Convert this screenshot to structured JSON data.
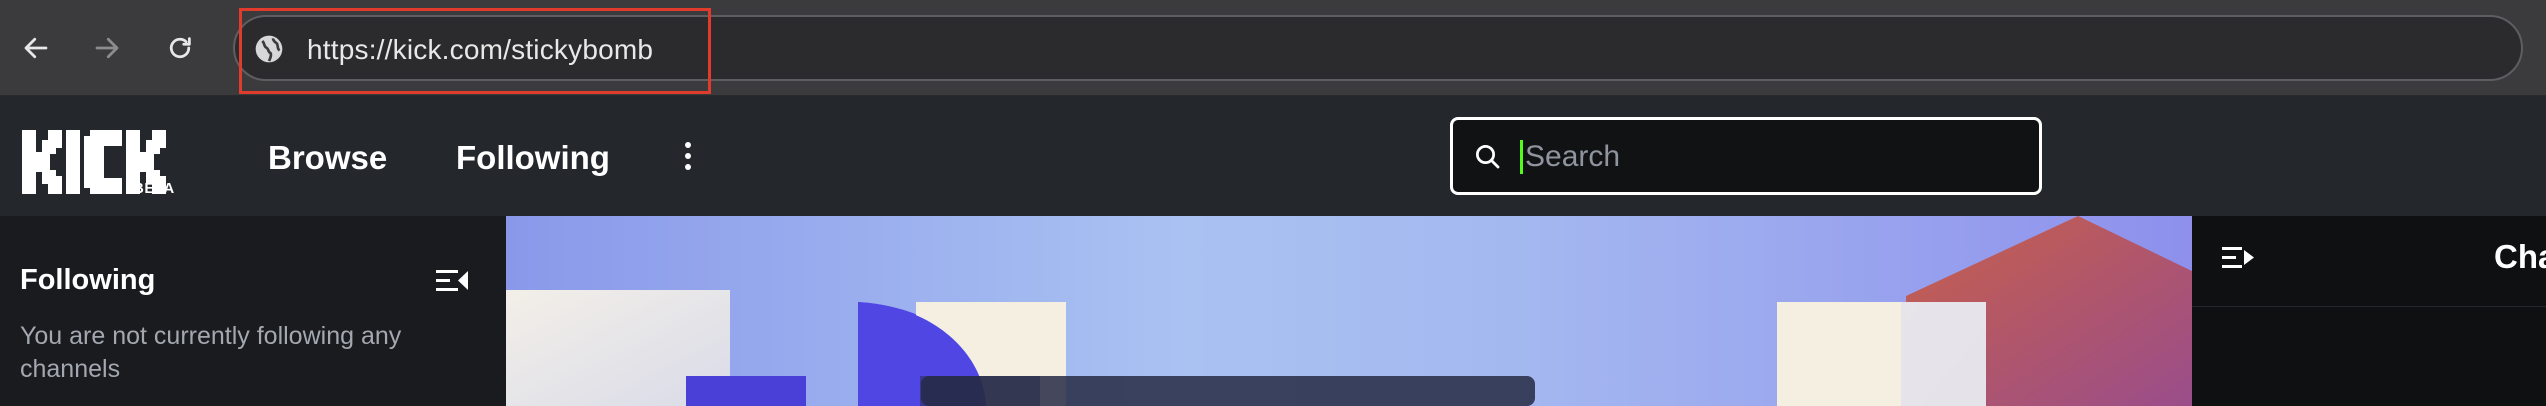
{
  "browser": {
    "url": "https://kick.com/stickybomb",
    "icons": {
      "back": "arrow-left-icon",
      "forward": "arrow-right-icon",
      "reload": "reload-icon",
      "site_info": "globe-icon"
    },
    "highlight_color": "#e13b2c"
  },
  "site": {
    "logo_text": "KICK",
    "beta_label": "BETA",
    "nav": {
      "browse": "Browse",
      "following": "Following"
    },
    "search": {
      "placeholder": "Search",
      "value": ""
    },
    "accent_color": "#53fc18"
  },
  "sidebar": {
    "title": "Following",
    "empty_message": "You are not currently following any channels"
  },
  "chat": {
    "title": "Chat"
  }
}
